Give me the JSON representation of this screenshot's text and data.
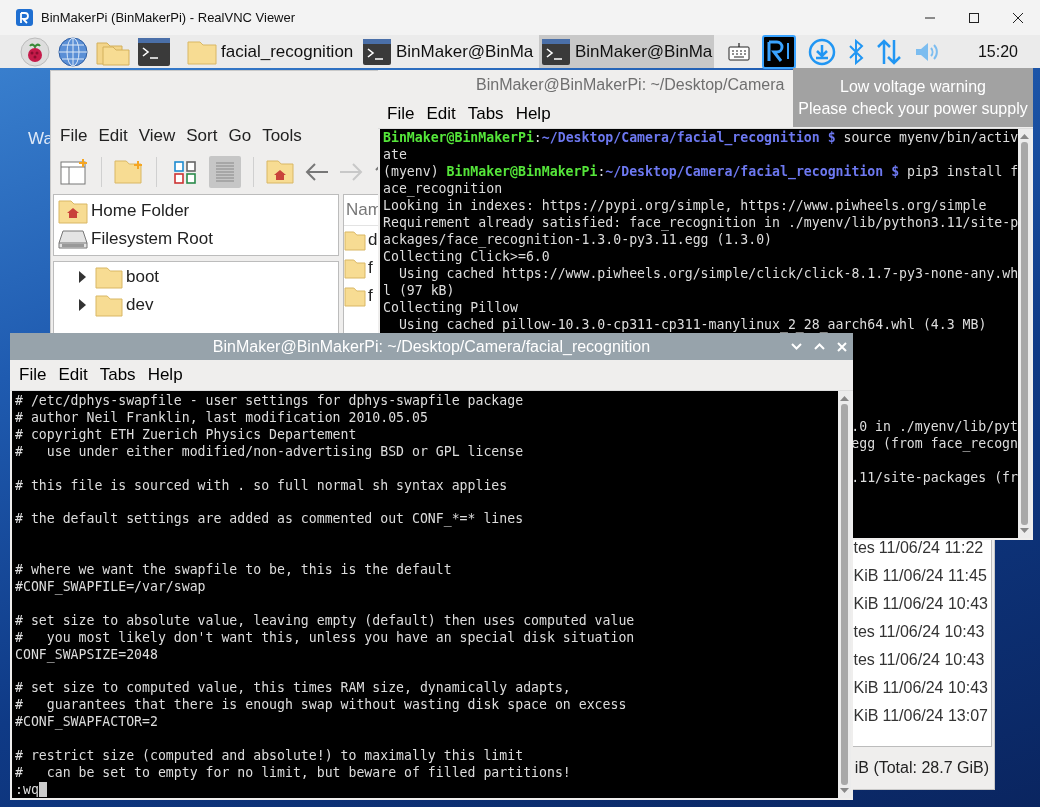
{
  "viewer": {
    "title": "BinMakerPi (BinMakerPi) - RealVNC Viewer"
  },
  "taskbar": {
    "launchers": [
      {
        "kind": "raspberry"
      },
      {
        "kind": "browser"
      },
      {
        "kind": "files"
      },
      {
        "kind": "terminal"
      }
    ],
    "tasks": [
      {
        "kind": "folder",
        "label": "facial_recognition",
        "selected": false
      },
      {
        "kind": "terminal",
        "label": "BinMaker@BinMa",
        "selected": false
      },
      {
        "kind": "terminal",
        "label": "BinMaker@BinMa",
        "selected": true
      }
    ],
    "tray": [
      {
        "kind": "keyboard"
      },
      {
        "kind": "vnc"
      },
      {
        "kind": "download"
      },
      {
        "kind": "bluetooth"
      },
      {
        "kind": "network"
      },
      {
        "kind": "volume"
      }
    ],
    "clock": "15:20"
  },
  "desktop": {
    "label_fragment": "Wa"
  },
  "file_manager": {
    "menu": [
      "File",
      "Edit",
      "View",
      "Sort",
      "Go",
      "Tools"
    ],
    "toolbar": [
      {
        "kind": "new-window"
      },
      {
        "kind": "separator"
      },
      {
        "kind": "new-folder"
      },
      {
        "kind": "separator"
      },
      {
        "kind": "icon-view",
        "selected": false
      },
      {
        "kind": "list-view",
        "selected": true
      },
      {
        "kind": "separator"
      },
      {
        "kind": "home"
      },
      {
        "kind": "back",
        "disabled": false
      },
      {
        "kind": "forward",
        "disabled": true
      },
      {
        "kind": "up",
        "disabled": false
      }
    ],
    "places": [
      {
        "kind": "home",
        "label": "Home Folder"
      },
      {
        "kind": "drive",
        "label": "Filesystem Root"
      }
    ],
    "tree": [
      {
        "label": "boot",
        "expanded": false
      },
      {
        "label": "dev",
        "expanded": false
      }
    ],
    "list_header": "Nam",
    "list_names": [
      "d",
      "f",
      "f"
    ],
    "list_details": [
      {
        "size": "tes",
        "modified": "11/06/24 11:22"
      },
      {
        "size": "KiB",
        "modified": "11/06/24 11:45"
      },
      {
        "size": "KiB",
        "modified": "11/06/24 10:43"
      },
      {
        "size": "tes",
        "modified": "11/06/24 10:43"
      },
      {
        "size": "tes",
        "modified": "11/06/24 10:43"
      },
      {
        "size": "KiB",
        "modified": "11/06/24 10:43"
      },
      {
        "size": "KiB",
        "modified": "11/06/24 13:07"
      }
    ],
    "status": "iB (Total: 28.7 GiB)"
  },
  "back_terminal": {
    "title": "BinMaker@BinMakerPi: ~/Desktop/Camera",
    "active": false,
    "menu": [
      "File",
      "Edit",
      "Tabs",
      "Help"
    ],
    "lines": [
      {
        "kind": "prompt",
        "segments": [
          {
            "kind": "user",
            "text": "BinMaker@BinMakerPi"
          },
          {
            "kind": "plain",
            "text": ":"
          },
          {
            "kind": "path",
            "text": "~/Desktop/Camera/facial_recognition $"
          },
          {
            "kind": "plain",
            "text": " source myenv/bin/activ"
          }
        ]
      },
      {
        "kind": "text",
        "text": "ate"
      },
      {
        "kind": "prompt",
        "segments": [
          {
            "kind": "plain",
            "text": "(myenv) "
          },
          {
            "kind": "user",
            "text": "BinMaker@BinMakerPi"
          },
          {
            "kind": "plain",
            "text": ":"
          },
          {
            "kind": "path",
            "text": "~/Desktop/Camera/facial_recognition $"
          },
          {
            "kind": "plain",
            "text": " pip3 install f"
          }
        ]
      },
      {
        "kind": "text",
        "text": "ace_recognition"
      },
      {
        "kind": "text",
        "text": "Looking in indexes: https://pypi.org/simple, https://www.piwheels.org/simple"
      },
      {
        "kind": "text",
        "text": "Requirement already satisfied: face_recognition in ./myenv/lib/python3.11/site-p"
      },
      {
        "kind": "text",
        "text": "ackages/face_recognition-1.3.0-py3.11.egg (1.3.0)"
      },
      {
        "kind": "text",
        "text": "Collecting Click>=6.0"
      },
      {
        "kind": "text",
        "text": "  Using cached https://www.piwheels.org/simple/click/click-8.1.7-py3-none-any.wh"
      },
      {
        "kind": "text",
        "text": "l (97 kB)"
      },
      {
        "kind": "text",
        "text": "Collecting Pillow"
      },
      {
        "kind": "text",
        "text": "  Using cached pillow-10.3.0-cp311-cp311-manylinux_2_28_aarch64.whl (4.3 MB)"
      }
    ],
    "tail_lines": [
      {
        "kind": "text",
        "text": ".0 in ./myenv/lib/pyt"
      },
      {
        "kind": "text",
        "text": "egg (from face_recogn"
      },
      {
        "kind": "blank"
      },
      {
        "kind": "text",
        "text": ".11/site-packages (fr"
      }
    ]
  },
  "notification": {
    "lines": [
      "Low voltage warning",
      "Please check your power supply"
    ]
  },
  "front_terminal": {
    "title": "BinMaker@BinMakerPi: ~/Desktop/Camera/facial_recognition",
    "active": true,
    "window_buttons": [
      {
        "kind": "minimize"
      },
      {
        "kind": "maximize"
      },
      {
        "kind": "close"
      }
    ],
    "menu": [
      "File",
      "Edit",
      "Tabs",
      "Help"
    ],
    "lines": [
      {
        "kind": "text",
        "text": "# /etc/dphys-swapfile - user settings for dphys-swapfile package"
      },
      {
        "kind": "text",
        "text": "# author Neil Franklin, last modification 2010.05.05"
      },
      {
        "kind": "text",
        "text": "# copyright ETH Zuerich Physics Departement"
      },
      {
        "kind": "text",
        "text": "#   use under either modified/non-advertising BSD or GPL license"
      },
      {
        "kind": "blank"
      },
      {
        "kind": "text",
        "text": "# this file is sourced with . so full normal sh syntax applies"
      },
      {
        "kind": "blank"
      },
      {
        "kind": "text",
        "text": "# the default settings are added as commented out CONF_*=* lines"
      },
      {
        "kind": "blank"
      },
      {
        "kind": "blank"
      },
      {
        "kind": "text",
        "text": "# where we want the swapfile to be, this is the default"
      },
      {
        "kind": "text",
        "text": "#CONF_SWAPFILE=/var/swap"
      },
      {
        "kind": "blank"
      },
      {
        "kind": "text",
        "text": "# set size to absolute value, leaving empty (default) then uses computed value"
      },
      {
        "kind": "text",
        "text": "#   you most likely don't want this, unless you have an special disk situation"
      },
      {
        "kind": "text",
        "text": "CONF_SWAPSIZE=2048"
      },
      {
        "kind": "blank"
      },
      {
        "kind": "text",
        "text": "# set size to computed value, this times RAM size, dynamically adapts,"
      },
      {
        "kind": "text",
        "text": "#   guarantees that there is enough swap without wasting disk space on excess"
      },
      {
        "kind": "text",
        "text": "#CONF_SWAPFACTOR=2"
      },
      {
        "kind": "blank"
      },
      {
        "kind": "text",
        "text": "# restrict size (computed and absolute!) to maximally this limit"
      },
      {
        "kind": "text",
        "text": "#   can be set to empty for no limit, but beware of filled partitions!"
      },
      {
        "kind": "input",
        "text": ":wq"
      }
    ]
  }
}
